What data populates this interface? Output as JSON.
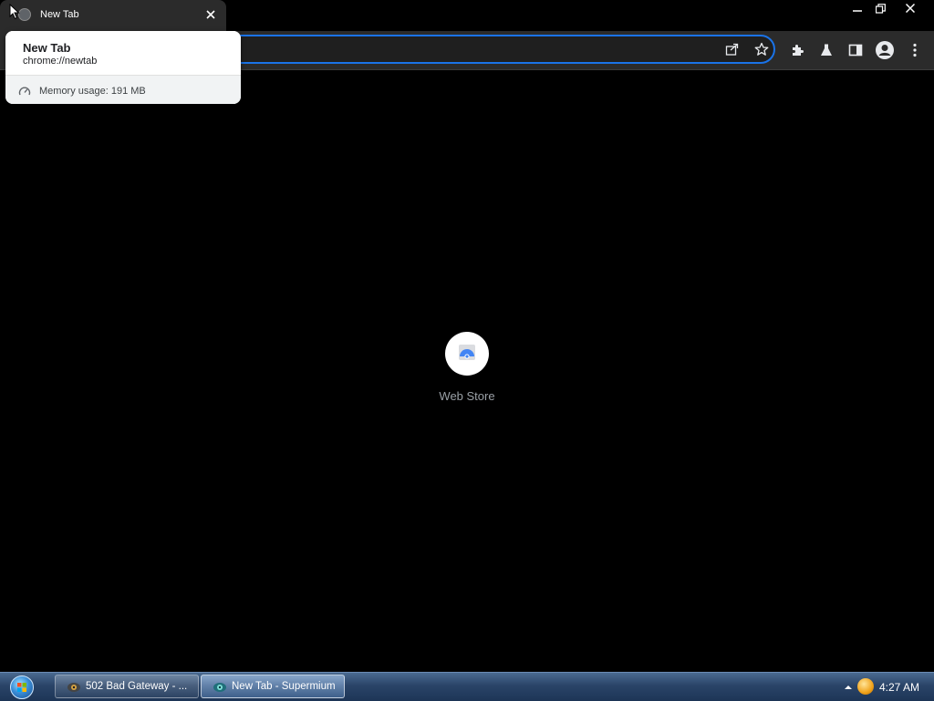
{
  "tab": {
    "title": "New Tab",
    "close_icon": "close-icon"
  },
  "hover_card": {
    "title": "New Tab",
    "url": "chrome://newtab",
    "memory": "Memory usage: 191 MB"
  },
  "omnibox": {
    "value": "",
    "placeholder": ""
  },
  "shortcuts": [
    {
      "label": "Web Store",
      "icon": "web-store-icon"
    }
  ],
  "taskbar": {
    "items": [
      {
        "label": "502 Bad Gateway - ...",
        "icon": "browser-icon",
        "active": false
      },
      {
        "label": "New Tab - Supermium",
        "icon": "supermium-icon",
        "active": true
      }
    ],
    "clock": "4:27 AM"
  },
  "colors": {
    "accent": "#1a73e8",
    "background": "#000000",
    "toolbar": "#2b2b2b"
  }
}
